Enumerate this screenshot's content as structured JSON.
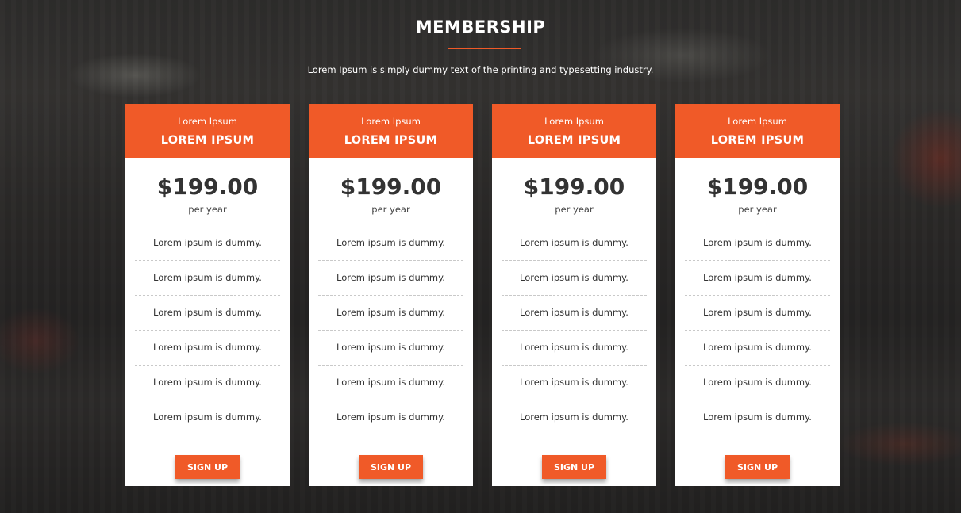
{
  "section": {
    "title": "MEMBERSHIP",
    "subtitle": "Lorem Ipsum is simply dummy text of the printing and typesetting industry."
  },
  "theme": {
    "accent": "#f05a28",
    "card_background": "#ffffff",
    "text_dark": "#333333"
  },
  "plans": [
    {
      "subtitle": "Lorem Ipsum",
      "title": "LOREM IPSUM",
      "price": "$199.00",
      "period": "per year",
      "features": [
        "Lorem ipsum is dummy.",
        "Lorem ipsum is dummy.",
        "Lorem ipsum is dummy.",
        "Lorem ipsum is dummy.",
        "Lorem ipsum is dummy.",
        "Lorem ipsum is dummy."
      ],
      "button": "SIGN UP"
    },
    {
      "subtitle": "Lorem Ipsum",
      "title": "LOREM IPSUM",
      "price": "$199.00",
      "period": "per year",
      "features": [
        "Lorem ipsum is dummy.",
        "Lorem ipsum is dummy.",
        "Lorem ipsum is dummy.",
        "Lorem ipsum is dummy.",
        "Lorem ipsum is dummy.",
        "Lorem ipsum is dummy."
      ],
      "button": "SIGN UP"
    },
    {
      "subtitle": "Lorem Ipsum",
      "title": "LOREM IPSUM",
      "price": "$199.00",
      "period": "per year",
      "features": [
        "Lorem ipsum is dummy.",
        "Lorem ipsum is dummy.",
        "Lorem ipsum is dummy.",
        "Lorem ipsum is dummy.",
        "Lorem ipsum is dummy.",
        "Lorem ipsum is dummy."
      ],
      "button": "SIGN UP"
    },
    {
      "subtitle": "Lorem Ipsum",
      "title": "LOREM IPSUM",
      "price": "$199.00",
      "period": "per year",
      "features": [
        "Lorem ipsum is dummy.",
        "Lorem ipsum is dummy.",
        "Lorem ipsum is dummy.",
        "Lorem ipsum is dummy.",
        "Lorem ipsum is dummy.",
        "Lorem ipsum is dummy."
      ],
      "button": "SIGN UP"
    }
  ]
}
